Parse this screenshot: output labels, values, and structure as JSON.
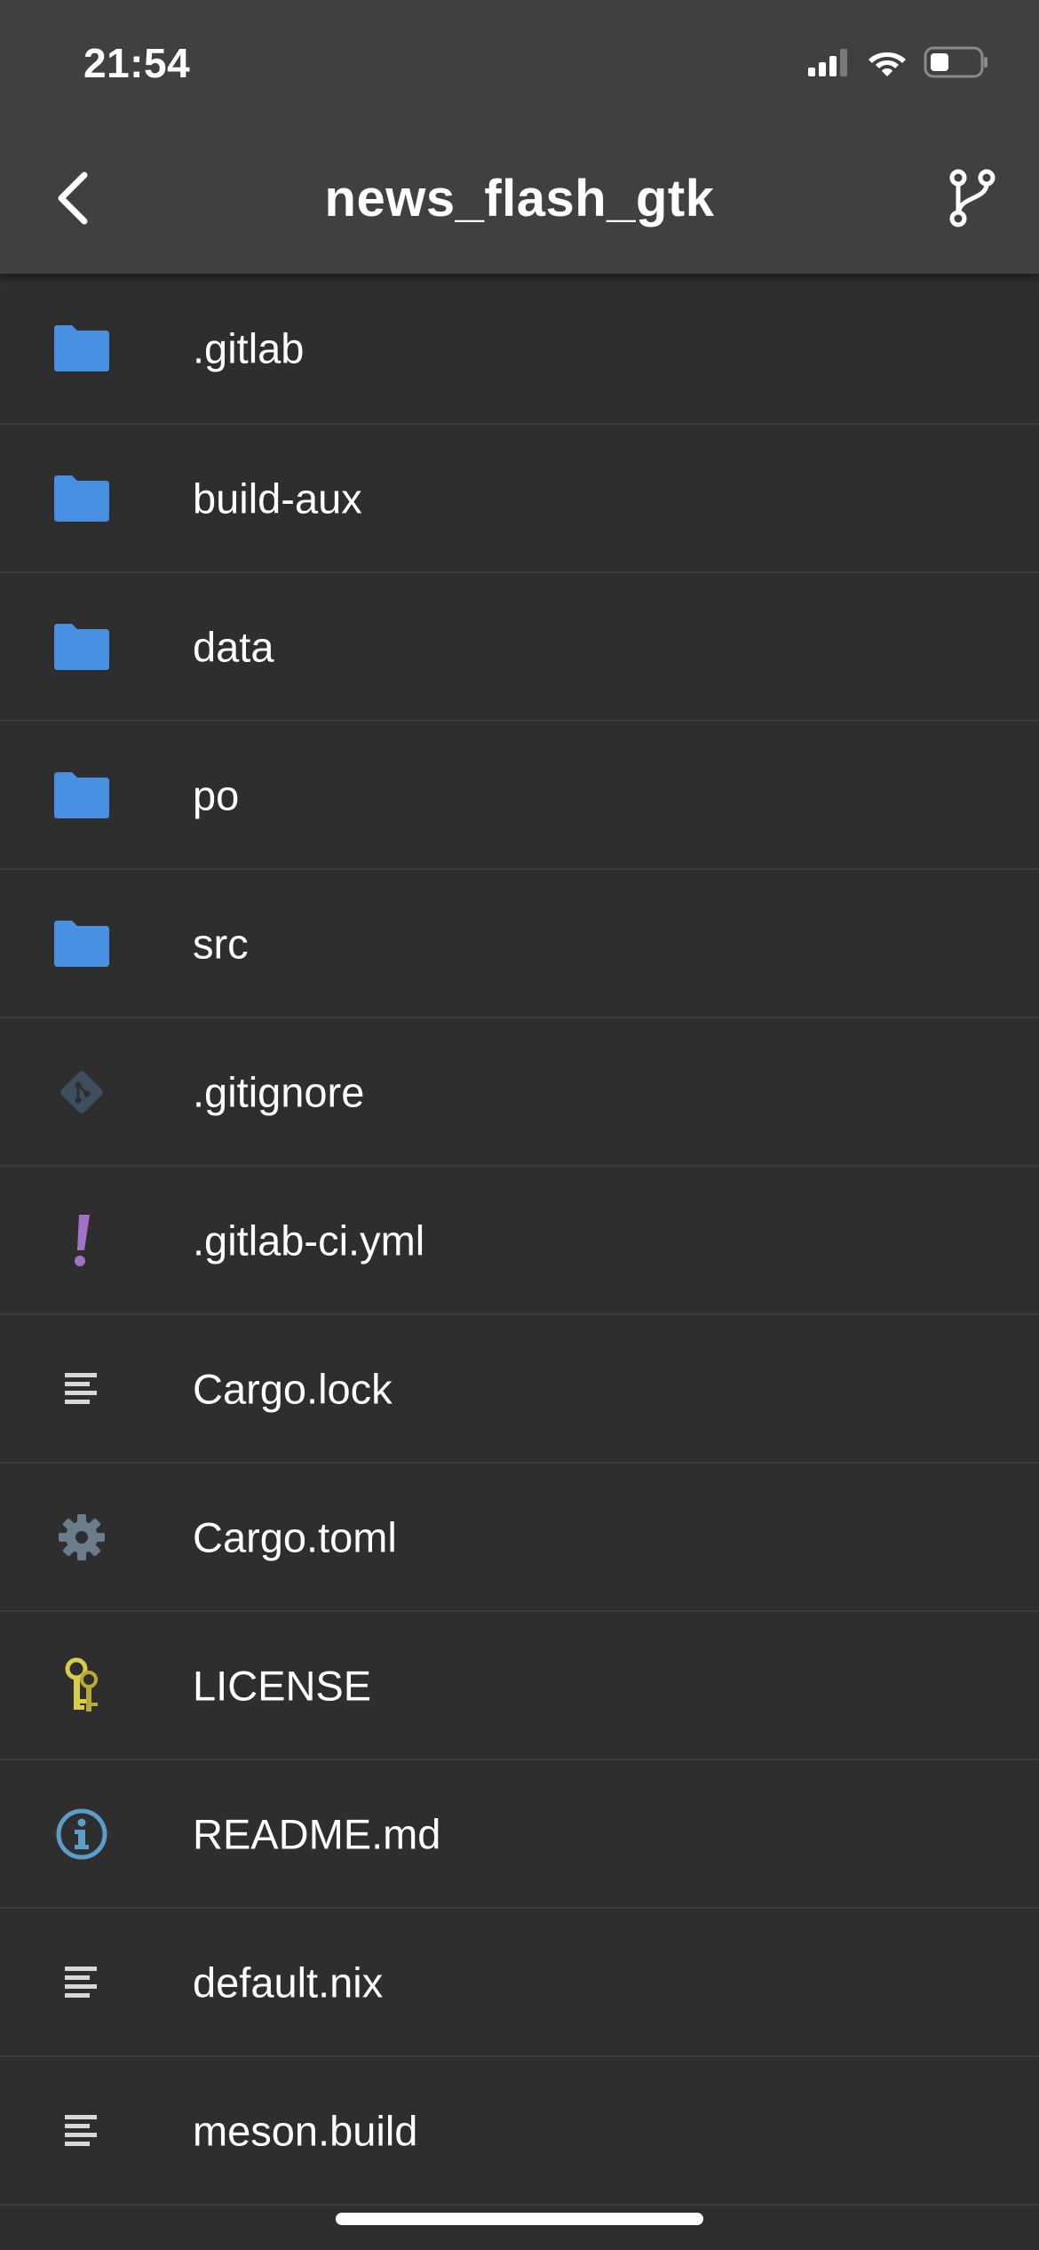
{
  "status_bar": {
    "time": "21:54",
    "icons": [
      "cellular-signal-icon",
      "wifi-icon",
      "battery-icon"
    ]
  },
  "nav": {
    "title": "news_flash_gtk",
    "back_icon": "chevron-left-icon",
    "branch_icon": "git-branch-icon"
  },
  "files": [
    {
      "name": ".gitlab",
      "icon": "folder-icon",
      "type": "folder"
    },
    {
      "name": "build-aux",
      "icon": "folder-icon",
      "type": "folder"
    },
    {
      "name": "data",
      "icon": "folder-icon",
      "type": "folder"
    },
    {
      "name": "po",
      "icon": "folder-icon",
      "type": "folder"
    },
    {
      "name": "src",
      "icon": "folder-icon",
      "type": "folder"
    },
    {
      "name": ".gitignore",
      "icon": "git-icon",
      "type": "file"
    },
    {
      "name": ".gitlab-ci.yml",
      "icon": "exclamation-icon",
      "type": "file"
    },
    {
      "name": "Cargo.lock",
      "icon": "text-lines-icon",
      "type": "file"
    },
    {
      "name": "Cargo.toml",
      "icon": "gear-icon",
      "type": "file"
    },
    {
      "name": "LICENSE",
      "icon": "keys-icon",
      "type": "file"
    },
    {
      "name": "README.md",
      "icon": "info-icon",
      "type": "file"
    },
    {
      "name": "default.nix",
      "icon": "text-lines-icon",
      "type": "file"
    },
    {
      "name": "meson.build",
      "icon": "text-lines-icon",
      "type": "file"
    }
  ],
  "colors": {
    "background": "#2e2e2e",
    "header": "#404040",
    "folder": "#4a90e2",
    "git": "#3d4e5c",
    "exclamation": "#a272c6",
    "text_icon": "#d8d8d8",
    "gear": "#6b7d8a",
    "keys": "#d9cc4a",
    "info": "#5b9ec9"
  }
}
